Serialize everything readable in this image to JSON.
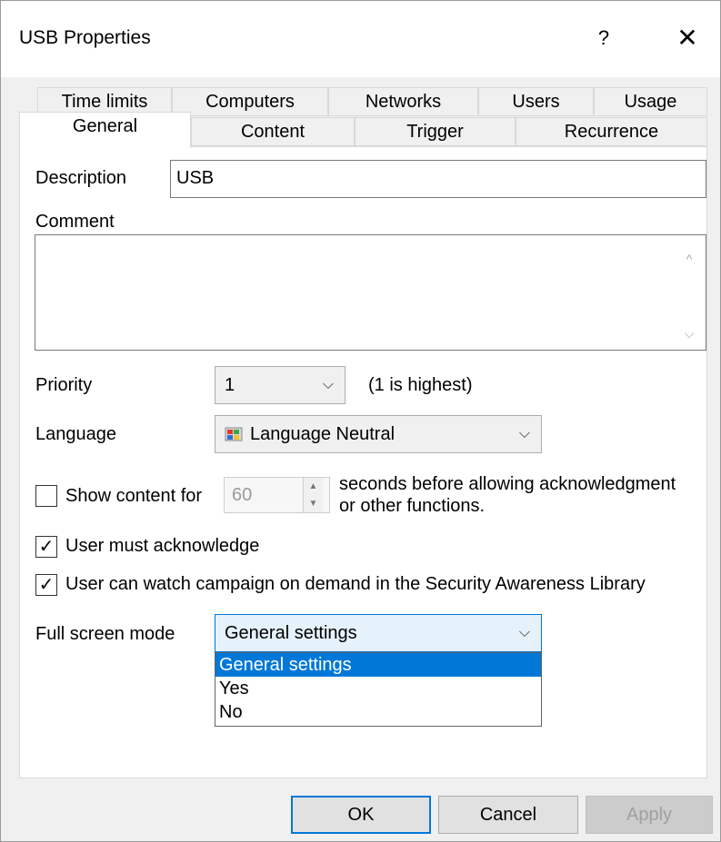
{
  "window": {
    "title": "USB Properties",
    "help_label": "?",
    "close_label": "✕"
  },
  "tabs": {
    "row1": [
      "Time limits",
      "Computers",
      "Networks",
      "Users",
      "Usage"
    ],
    "row2": [
      "General",
      "Content",
      "Trigger",
      "Recurrence"
    ],
    "active": "General"
  },
  "general": {
    "description_label": "Description",
    "description_value": "USB",
    "comment_label": "Comment",
    "comment_value": "",
    "priority_label": "Priority",
    "priority_value": "1",
    "priority_hint": "(1 is highest)",
    "language_label": "Language",
    "language_value": "Language Neutral",
    "show_content_label": "Show content for",
    "show_content_checked": false,
    "show_content_seconds": "60",
    "show_content_suffix_line1": "seconds before allowing acknowledgment",
    "show_content_suffix_line2": "or other functions.",
    "must_ack_label": "User must acknowledge",
    "must_ack_checked": true,
    "watch_on_demand_label": "User can watch campaign on demand in the Security Awareness Library",
    "watch_on_demand_checked": true,
    "fullscreen_label": "Full screen mode",
    "fullscreen_value": "General settings",
    "fullscreen_options": [
      "General settings",
      "Yes",
      "No"
    ],
    "fullscreen_highlighted": "General settings"
  },
  "buttons": {
    "ok": "OK",
    "cancel": "Cancel",
    "apply": "Apply"
  },
  "glyphs": {
    "chevron_down": "⌵",
    "chevron_up": "^",
    "check": "✓",
    "spin_up": "▲",
    "spin_down": "▼"
  },
  "colors": {
    "accent": "#0078d7",
    "selection": "#0078d7"
  }
}
